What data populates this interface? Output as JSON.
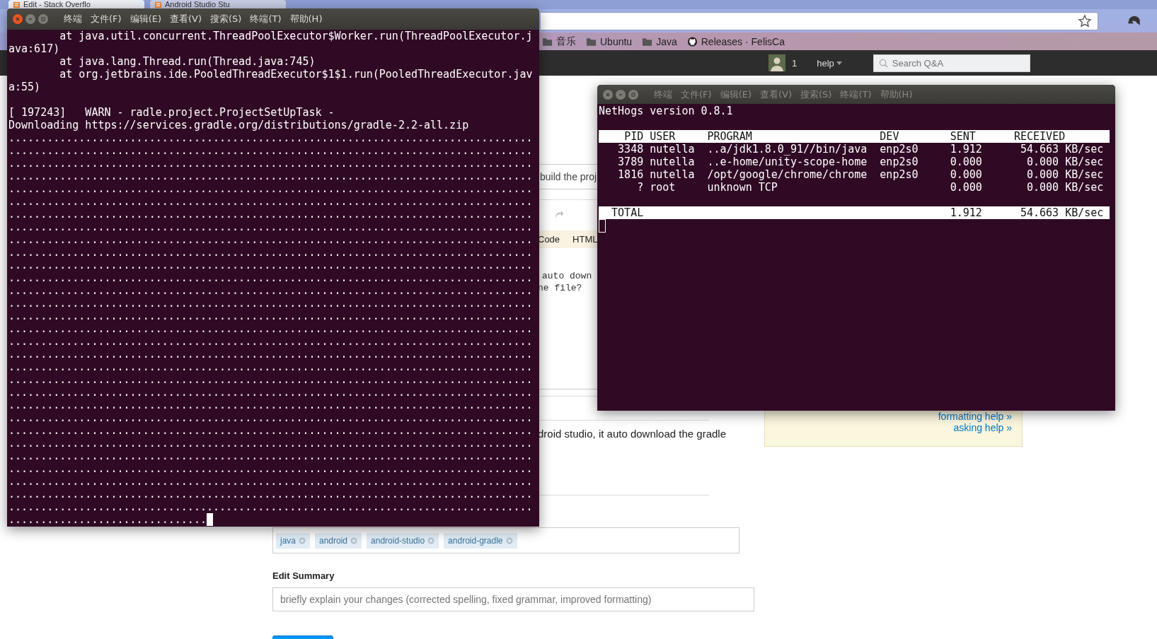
{
  "browser": {
    "tabs": [
      {
        "label": "Edit - Stack Overflo",
        "selected": true
      },
      {
        "label": "Android Studio Stu",
        "selected": false
      }
    ],
    "bookmarks": [
      {
        "label": "音乐",
        "kind": "folder"
      },
      {
        "label": "Ubuntu",
        "kind": "folder"
      },
      {
        "label": "Java",
        "kind": "folder"
      },
      {
        "label": "Releases · FelisCa",
        "kind": "github"
      }
    ],
    "topbar": {
      "reputation": "1",
      "help": "help",
      "search": {
        "placeholder": "Search Q&A"
      }
    }
  },
  "page": {
    "title_fragment": "build the proj",
    "toolbar": [
      "Code",
      "HTML"
    ],
    "editor_lines": [
      "auto down",
      "ne file?"
    ],
    "preview_fragment": "droid studio, it auto download the gradle",
    "tags": [
      "java",
      "android",
      "android-studio",
      "android-gradle"
    ],
    "edit_summary": {
      "label": "Edit Summary",
      "placeholder": "briefly explain your changes (corrected spelling, fixed grammar, improved formatting)"
    },
    "sidebar_links": [
      "formatting help »",
      "asking help »"
    ]
  },
  "terminals": [
    {
      "kind": "log",
      "active": true,
      "menu": [
        "终端",
        "文件(F)",
        "编辑(E)",
        "查看(V)",
        "搜索(S)",
        "终端(T)",
        "帮助(H)"
      ],
      "stack_trace": [
        "        at java.util.concurrent.ThreadPoolExecutor$Worker.run(ThreadPoolExecutor.j",
        "ava:617)",
        "        at java.lang.Thread.run(Thread.java:745)",
        "        at org.jetbrains.ide.PooledThreadExecutor$1$1.run(PooledThreadExecutor.jav",
        "a:55)"
      ],
      "log": [
        "[ 197243]   WARN - radle.project.ProjectSetUpTask -",
        "Downloading https://services.gradle.org/distributions/gradle-2.2-all.zip"
      ],
      "progress": [
        "..................................................................................",
        "..................................................................................",
        "..................................................................................",
        "..................................................................................",
        "..................................................................................",
        "..................................................................................",
        "..................................................................................",
        "..................................................................................",
        "..................................................................................",
        "..................................................................................",
        "..................................................................................",
        "..................................................................................",
        "..................................................................................",
        "..................................................................................",
        "..................................................................................",
        "..................................................................................",
        "..................................................................................",
        "..................................................................................",
        "..................................................................................",
        "..................................................................................",
        "..................................................................................",
        "..................................................................................",
        "..................................................................................",
        "..................................................................................",
        "..................................................................................",
        "..................................................................................",
        "..................................................................................",
        "..................................................................................",
        "..................................................................................",
        "..................................................................................",
        "..............................."
      ]
    },
    {
      "kind": "nethogs",
      "active": false,
      "menu": [
        "终端",
        "文件(F)",
        "编辑(E)",
        "查看(V)",
        "搜索(S)",
        "终端(T)",
        "帮助(H)"
      ],
      "version": "NetHogs version 0.8.1",
      "columns": [
        "PID",
        "USER",
        "PROGRAM",
        "DEV",
        "SENT",
        "RECEIVED"
      ],
      "rows": [
        {
          "pid": "3348",
          "user": "nutella",
          "program": "..a/jdk1.8.0_91//bin/java",
          "dev": "enp2s0",
          "sent": "1.912",
          "received": "54.663 KB/sec"
        },
        {
          "pid": "3789",
          "user": "nutella",
          "program": "..e-home/unity-scope-home",
          "dev": "enp2s0",
          "sent": "0.000",
          "received": "0.000 KB/sec"
        },
        {
          "pid": "1816",
          "user": "nutella",
          "program": "/opt/google/chrome/chrome",
          "dev": "enp2s0",
          "sent": "0.000",
          "received": "0.000 KB/sec"
        },
        {
          "pid": "?",
          "user": "root",
          "program": "unknown TCP",
          "sent": "0.000",
          "received": "0.000 KB/sec"
        }
      ],
      "total": {
        "label": "TOTAL",
        "sent": "1.912",
        "received": "54.663 KB/sec"
      }
    }
  ]
}
